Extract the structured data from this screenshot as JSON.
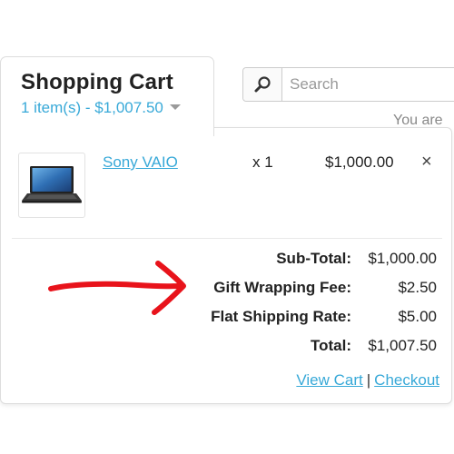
{
  "header": {
    "title": "Shopping Cart",
    "cart_summary": "1 item(s) - $1,007.50"
  },
  "search": {
    "placeholder": "Search",
    "icon": "search-icon"
  },
  "background_text": "You are",
  "cart": {
    "items": [
      {
        "name": "Sony VAIO",
        "quantity": "x 1",
        "price": "$1,000.00",
        "remove": "×",
        "thumbnail": "laptop-image"
      }
    ],
    "totals": [
      {
        "label": "Sub-Total:",
        "value": "$1,000.00"
      },
      {
        "label": "Gift Wrapping Fee:",
        "value": "$2.50"
      },
      {
        "label": "Flat Shipping Rate:",
        "value": "$5.00"
      },
      {
        "label": "Total:",
        "value": "$1,007.50"
      }
    ],
    "links": {
      "view_cart": "View Cart",
      "separator": "|",
      "checkout": "Checkout"
    }
  },
  "colors": {
    "link": "#38a9d8",
    "annotation_arrow": "#e8131b",
    "border": "#dddddd"
  }
}
